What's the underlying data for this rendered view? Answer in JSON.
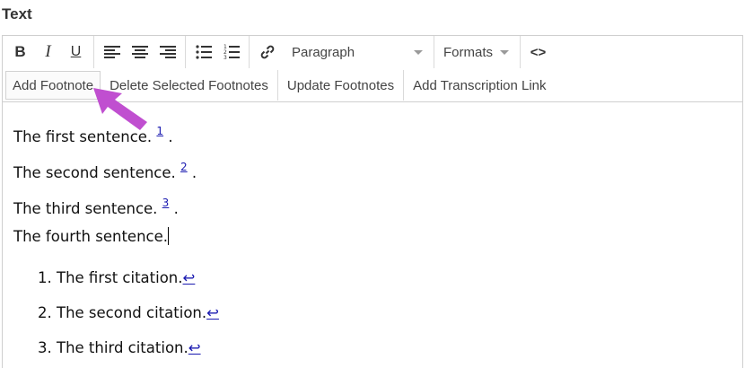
{
  "field_label": "Text",
  "toolbar": {
    "bold_label": "B",
    "italic_label": "I",
    "underline_label": "U",
    "block_format": "Paragraph",
    "formats_label": "Formats",
    "source_label": "<>",
    "icons": [
      "bold-icon",
      "italic-icon",
      "underline-icon",
      "align-left-icon",
      "align-center-icon",
      "align-right-icon",
      "bullet-list-icon",
      "numbered-list-icon",
      "link-icon",
      "source-code-icon"
    ],
    "row2": {
      "add_footnote": "Add Footnote",
      "delete_footnotes": "Delete Selected Footnotes",
      "update_footnotes": "Update Footnotes",
      "add_transcription_link": "Add Transcription Link"
    }
  },
  "content": {
    "paragraphs": [
      {
        "text": "The first sentence.",
        "ref": "1",
        "end": "."
      },
      {
        "text": "The second sentence.",
        "ref": "2",
        "end": "."
      },
      {
        "text": "The third sentence.",
        "ref": "3",
        "end": "."
      },
      {
        "text": "The fourth sentence.",
        "ref": "",
        "end": ""
      }
    ],
    "footnotes": [
      {
        "number": "1.",
        "text": "The first citation.",
        "backref": "↩"
      },
      {
        "number": "2.",
        "text": "The second citation.",
        "backref": "↩"
      },
      {
        "number": "3.",
        "text": "The third citation.",
        "backref": "↩"
      }
    ]
  },
  "annotation": {
    "color": "#c04fd0"
  }
}
